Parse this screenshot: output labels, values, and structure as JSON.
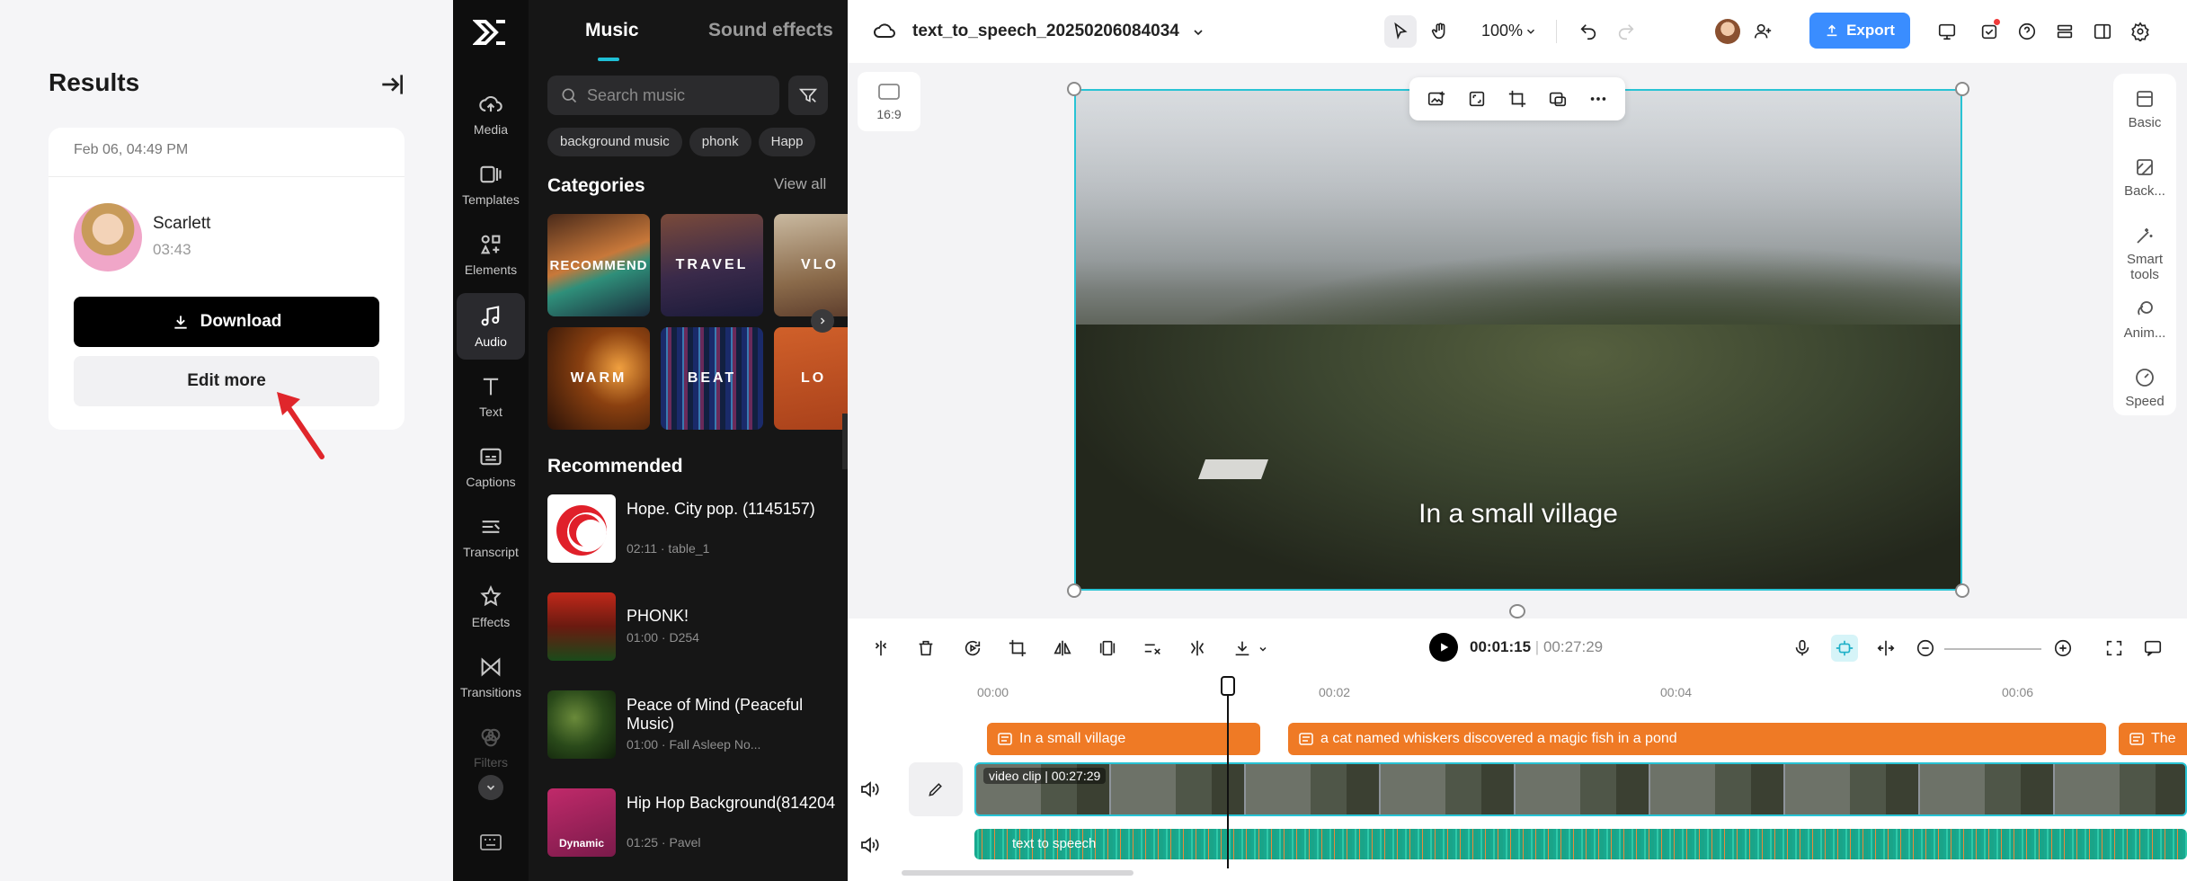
{
  "results": {
    "title": "Results",
    "date": "Feb 06, 04:49 PM",
    "voice_name": "Scarlett",
    "voice_duration": "03:43",
    "download_label": "Download",
    "edit_more_label": "Edit more"
  },
  "nav": {
    "items": [
      {
        "label": "Media",
        "icon": "cloud-upload-icon"
      },
      {
        "label": "Templates",
        "icon": "templates-icon"
      },
      {
        "label": "Elements",
        "icon": "elements-icon"
      },
      {
        "label": "Audio",
        "icon": "music-note-icon"
      },
      {
        "label": "Text",
        "icon": "text-icon"
      },
      {
        "label": "Captions",
        "icon": "captions-icon"
      },
      {
        "label": "Transcript",
        "icon": "transcript-icon"
      },
      {
        "label": "Effects",
        "icon": "effects-icon"
      },
      {
        "label": "Transitions",
        "icon": "transitions-icon"
      },
      {
        "label": "Filters",
        "icon": "filters-icon"
      }
    ]
  },
  "panel": {
    "tabs": [
      "Music",
      "Sound effects"
    ],
    "search_placeholder": "Search music",
    "chips": [
      "background music",
      "phonk",
      "Happ"
    ],
    "categories_title": "Categories",
    "view_all": "View all",
    "categories": [
      "RECOMMEND",
      "TRAVEL",
      "VLO",
      "WARM",
      "BEAT",
      "LO"
    ],
    "recommended_title": "Recommended",
    "tracks": [
      {
        "title": "Hope. City pop. (1145157)",
        "meta": "02:11 · table_1"
      },
      {
        "title": "PHONK!",
        "meta": "01:00 · D254"
      },
      {
        "title": "Peace of Mind (Peaceful Music)",
        "meta": "01:00 · Fall Asleep No..."
      },
      {
        "title": "Hip Hop Background(814204",
        "meta": "01:25 · Pavel",
        "thumb_text": "Dynamic"
      }
    ]
  },
  "editor": {
    "project_name": "text_to_speech_20250206084034",
    "zoom": "100%",
    "export_label": "Export",
    "ratio_label": "16:9",
    "caption_text": "In a small village",
    "right_panel": [
      "Basic",
      "Back...",
      "Smart tools",
      "Anim...",
      "Speed"
    ],
    "current_time": "00:01:15",
    "total_time": "00:27:29"
  },
  "timeline": {
    "ticks": [
      "00:00",
      "00:02",
      "00:04",
      "00:06"
    ],
    "text_clips": [
      "In a small village",
      "a cat named whiskers discovered a magic fish in a pond",
      "The"
    ],
    "video_label": "video clip",
    "video_duration": "00:27:29",
    "audio_label": "text to speech"
  },
  "colors": {
    "accent": "#28c3d4",
    "export": "#3a8dff",
    "text_clip": "#ef7a25",
    "audio_clip": "#1aa488",
    "arrow": "#e0262b"
  }
}
